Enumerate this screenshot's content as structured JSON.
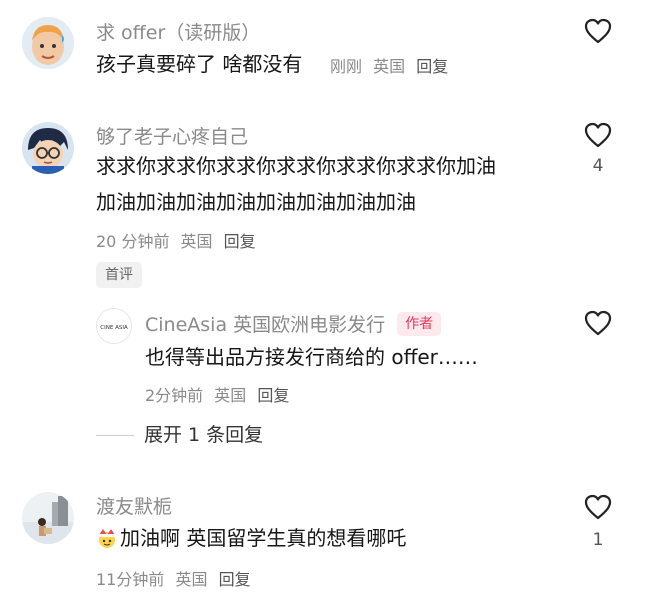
{
  "comments": [
    {
      "username": "求 offer（读研版）",
      "text_lines": [
        "孩子真要碎了 啥都没有"
      ],
      "time": "刚刚",
      "location": "英国",
      "reply_label": "回复",
      "like_count": ""
    },
    {
      "username": "够了老子心疼自己",
      "text_lines": [
        "求求你求求你求求你求求你求求你求求你加油",
        "加油加油加油加油加油加油加油加油"
      ],
      "time": "20 分钟前",
      "location": "英国",
      "reply_label": "回复",
      "like_count": "4",
      "tag": "首评"
    },
    {
      "username": "CineAsia 英国欧洲电影发行",
      "badge": "作者",
      "avatar_text": "CINE ASIA",
      "text_lines": [
        "也得等出品方接发行商给的 offer……"
      ],
      "time": "2分钟前",
      "location": "英国",
      "reply_label": "回复",
      "like_count": ""
    },
    {
      "username": "渡友默栀",
      "text_lines": [
        "加油啊 英国留学生真的想看哪吒"
      ],
      "time": "11分钟前",
      "location": "英国",
      "reply_label": "回复",
      "like_count": "1"
    }
  ],
  "expand_replies": "展开 1 条回复",
  "icons": {
    "like": "heart-outline-icon",
    "emoji": "cheer-emoji-icon"
  },
  "colors": {
    "badge_text": "#e5375c",
    "badge_bg": "#fde9ee",
    "meta": "#8a8a8a"
  }
}
